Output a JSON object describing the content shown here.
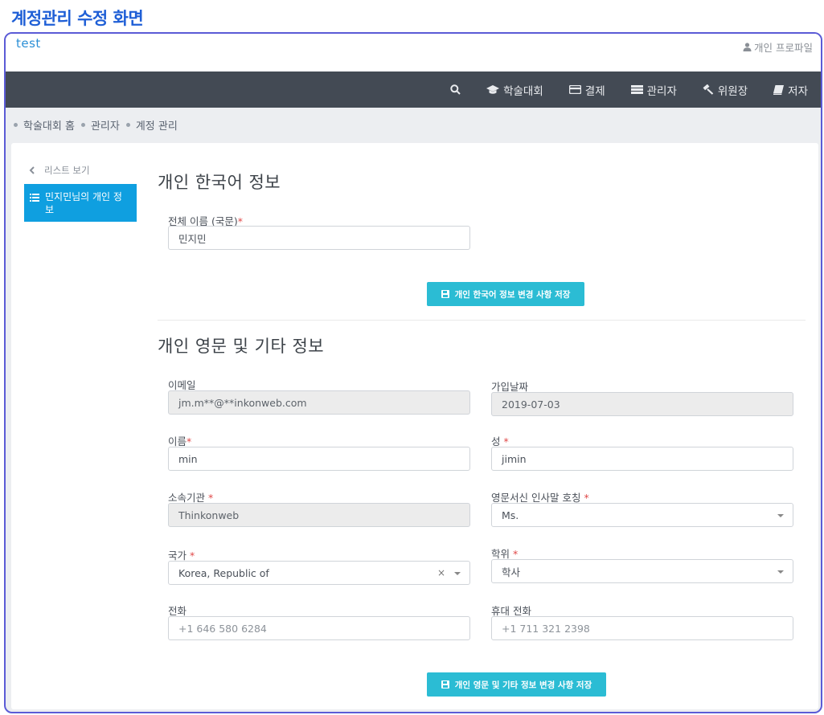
{
  "caption": "계정관리 수정 화면",
  "brand": "test",
  "profile_label": "개인 프로파일",
  "nav": [
    {
      "label": "",
      "icon": "search-icon"
    },
    {
      "label": "학술대회",
      "icon": "graduation-cap-icon"
    },
    {
      "label": "결제",
      "icon": "credit-card-icon"
    },
    {
      "label": "관리자",
      "icon": "server-icon"
    },
    {
      "label": "위원장",
      "icon": "gavel-icon"
    },
    {
      "label": "저자",
      "icon": "book-icon"
    }
  ],
  "breadcrumb": [
    "학술대회 홈",
    "관리자",
    "계정 관리"
  ],
  "sidebar": {
    "back_label": "리스트 보기",
    "active_label": "민지민님의 개인 정보"
  },
  "korean_section": {
    "title": "개인 한국어 정보",
    "full_name_label": "전체 이름 (국문)",
    "full_name_value": "민지민",
    "save_label": "개인 한국어 정보 변경 사항 저장"
  },
  "english_section": {
    "title": "개인 영문 및 기타 정보",
    "email_label": "이메일",
    "email_value": "jm.m**@**inkonweb.com",
    "join_date_label": "가입날짜",
    "join_date_value": "2019-07-03",
    "first_name_label": "이름",
    "first_name_value": "min",
    "last_name_label": "성",
    "last_name_value": "jimin",
    "affiliation_label": "소속기관",
    "affiliation_value": "Thinkonweb",
    "salutation_label": "영문서신 인사말 호칭",
    "salutation_value": "Ms.",
    "country_label": "국가",
    "country_value": "Korea, Republic of",
    "degree_label": "학위",
    "degree_value": "학사",
    "phone_label": "전화",
    "phone_placeholder": "+1 646 580 6284",
    "mobile_label": "휴대 전화",
    "mobile_placeholder": "+1 711 321 2398",
    "save_label": "개인 영문 및 기타 정보 변경 사항 저장"
  },
  "required_mark": "*",
  "clear_mark": "×",
  "colors": {
    "accent": "#2bbcd4",
    "nav_bg": "#434a54",
    "sidebar_active": "#0f9fe0",
    "required": "#e04848"
  }
}
